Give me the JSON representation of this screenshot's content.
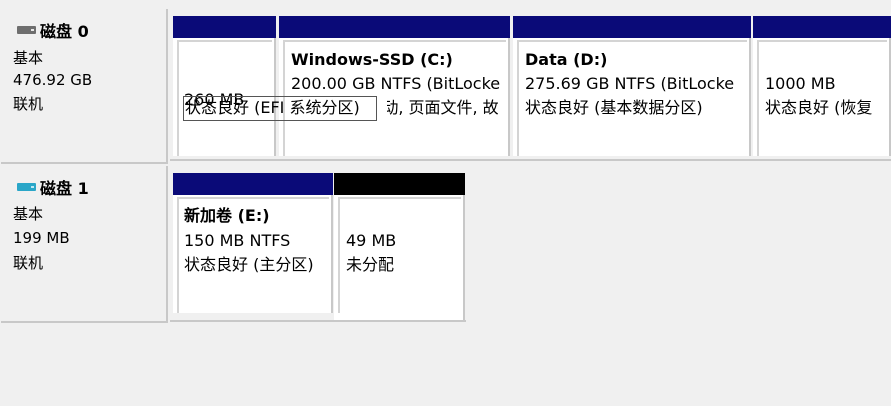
{
  "disks": [
    {
      "title": "磁盘 0",
      "type": "基本",
      "size": "476.92 GB",
      "status": "联机",
      "icon": "disk-drive-icon",
      "icon_color": "#6e6e6e",
      "partitions": [
        {
          "name": "",
          "line1": "260 MB",
          "line2": "状态良好 (EFI 系统分区)",
          "bar_color": "#0a0a78"
        },
        {
          "name": "Windows-SSD  (C:)",
          "line1": "200.00 GB NTFS (BitLocke",
          "line2": "状态良好 (启动, 页面文件, 故",
          "bar_color": "#0a0a78"
        },
        {
          "name": "Data  (D:)",
          "line1": "275.69 GB NTFS (BitLocke",
          "line2": "状态良好 (基本数据分区)",
          "bar_color": "#0a0a78"
        },
        {
          "name": "",
          "line1": "1000 MB",
          "line2": "状态良好 (恢复",
          "bar_color": "#0a0a78"
        }
      ]
    },
    {
      "title": "磁盘 1",
      "type": "基本",
      "size": "199 MB",
      "status": "联机",
      "icon": "removable-disk-icon",
      "icon_color": "#2aa6c8",
      "partitions": [
        {
          "name": "新加卷  (E:)",
          "line1": "150 MB NTFS",
          "line2": "状态良好 (主分区)",
          "bar_color": "#0a0a78"
        },
        {
          "name": "",
          "line1": "49 MB",
          "line2": "未分配",
          "bar_color": "#000000"
        }
      ]
    }
  ]
}
